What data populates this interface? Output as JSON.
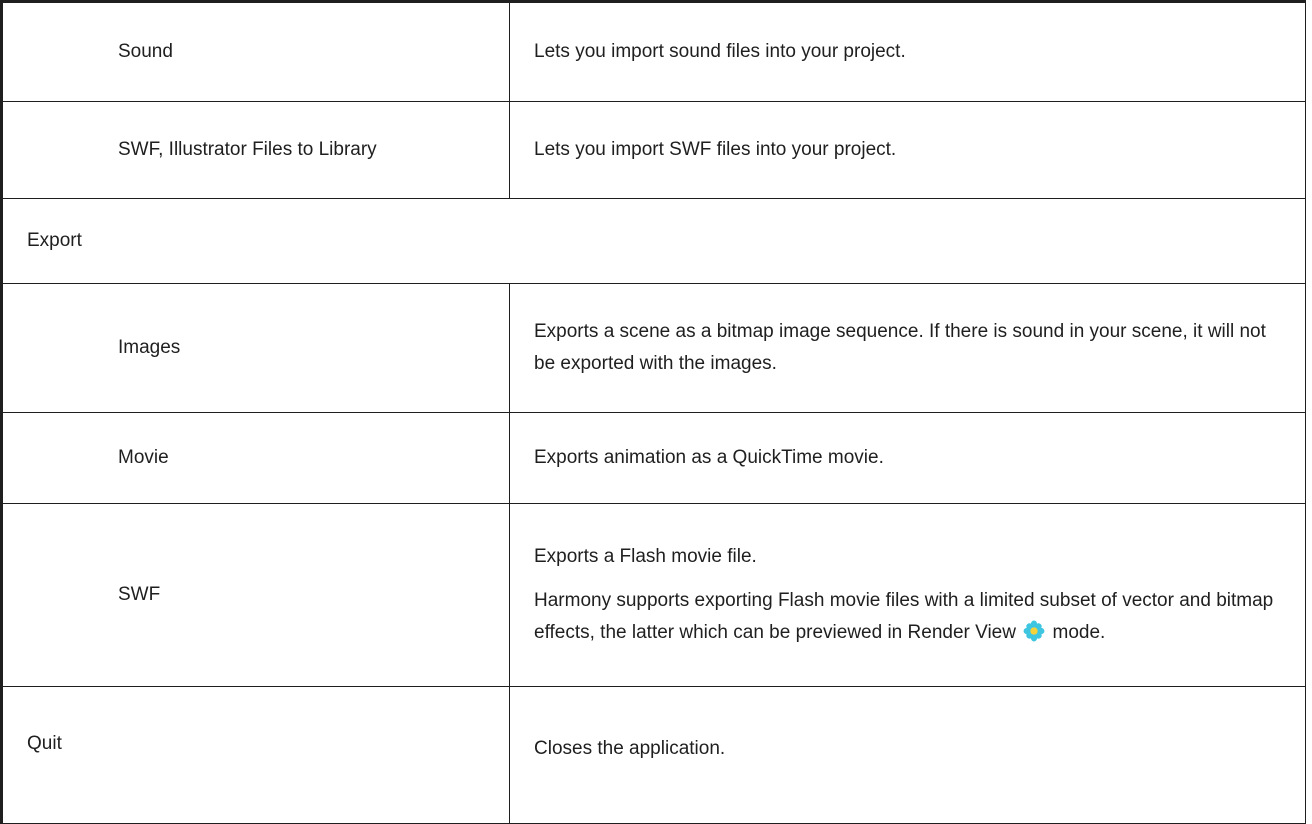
{
  "rows": [
    {
      "name": "Sound",
      "desc": "Lets you import sound files into your project."
    },
    {
      "name": "SWF, Illustrator Files to Library",
      "desc": "Lets you import SWF files into your project."
    },
    {
      "section": "Export"
    },
    {
      "name": "Images",
      "desc": "Exports a scene as a bitmap image sequence. If there is sound in your scene, it will not be exported with the images."
    },
    {
      "name": "Movie",
      "desc": "Exports animation as a QuickTime movie."
    },
    {
      "name": "SWF",
      "desc1": "Exports a Flash movie file.",
      "desc2_before": "Harmony supports exporting Flash movie files with a limited subset of vector and bitmap effects, the latter which can be previewed in Render View",
      "desc2_after": "mode.",
      "icon": "render-view-flower-icon"
    },
    {
      "name": "Quit",
      "desc": "Closes the application."
    }
  ],
  "colors": {
    "border": "#1f1f1f",
    "text": "#1f1f1f",
    "icon_petal": "#3ec6e0",
    "icon_center": "#f5d23a"
  }
}
